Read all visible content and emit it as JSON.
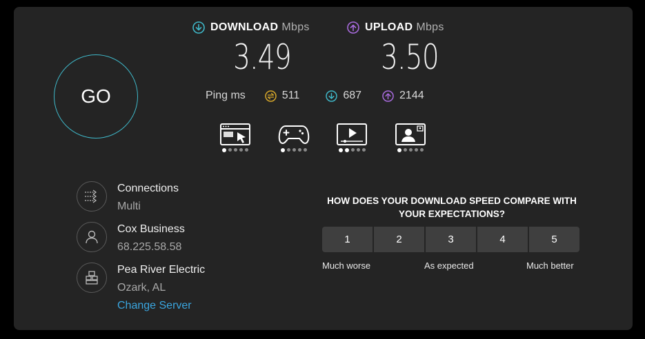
{
  "download": {
    "label": "DOWNLOAD",
    "unit": "Mbps",
    "value": "3.49",
    "color": "#3fb8c9"
  },
  "upload": {
    "label": "UPLOAD",
    "unit": "Mbps",
    "value": "3.50",
    "color": "#a96bde"
  },
  "go_label": "GO",
  "ping": {
    "label": "Ping ms",
    "idle": {
      "value": "511",
      "icon": "ping-icon",
      "color": "#d8a82a"
    },
    "download": {
      "value": "687",
      "icon": "download-arrow-icon",
      "color": "#3fb8c9"
    },
    "upload": {
      "value": "2144",
      "icon": "upload-arrow-icon",
      "color": "#a96bde"
    }
  },
  "quality_tiles": [
    {
      "icon": "web-browsing-icon",
      "level": 1,
      "max": 5
    },
    {
      "icon": "gaming-icon",
      "level": 1,
      "max": 5
    },
    {
      "icon": "video-streaming-icon",
      "level": 2,
      "max": 5
    },
    {
      "icon": "video-chat-icon",
      "level": 1,
      "max": 5
    }
  ],
  "info": {
    "connections": {
      "title": "Connections",
      "value": "Multi"
    },
    "provider": {
      "title": "Cox Business",
      "value": "68.225.58.58"
    },
    "server": {
      "title": "Pea River Electric",
      "value": "Ozark, AL",
      "change_label": "Change Server"
    }
  },
  "survey": {
    "question": "HOW DOES YOUR DOWNLOAD SPEED COMPARE WITH YOUR EXPECTATIONS?",
    "options": [
      "1",
      "2",
      "3",
      "4",
      "5"
    ],
    "low_label": "Much worse",
    "mid_label": "As expected",
    "high_label": "Much better"
  }
}
